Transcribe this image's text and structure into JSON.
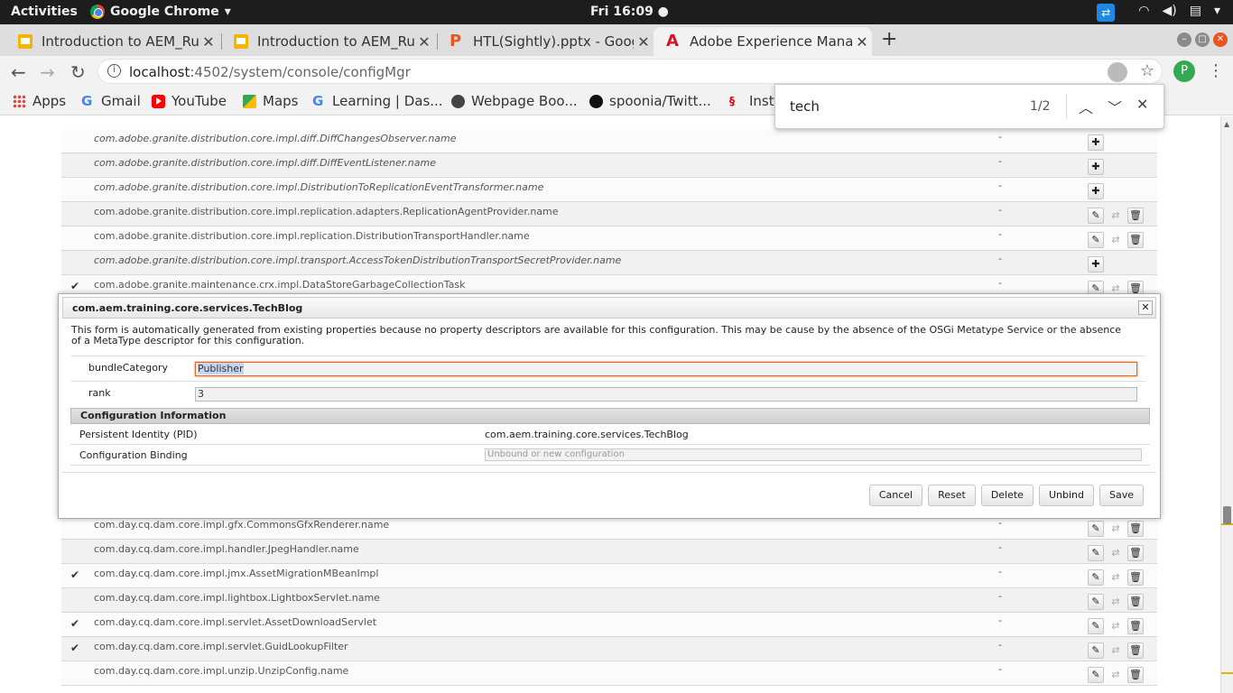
{
  "system": {
    "activities": "Activities",
    "app_name": "Google Chrome",
    "clock": "Fri 16:09 ●"
  },
  "tabs": [
    {
      "title": "Introduction to AEM_Run",
      "icon": "slides-icon",
      "active": false
    },
    {
      "title": "Introduction to AEM_Run",
      "icon": "slides-icon",
      "active": false
    },
    {
      "title": "HTL(Sightly).pptx - Google",
      "icon": "pptx-icon",
      "active": false
    },
    {
      "title": "Adobe Experience Manag",
      "icon": "adobe-icon",
      "active": true
    }
  ],
  "toolbar": {
    "url_host": "localhost",
    "url_rest": ":4502/system/console/configMgr",
    "profile_initial": "P"
  },
  "bookmarks": [
    {
      "label": "Apps",
      "icon": "apps-icon"
    },
    {
      "label": "Gmail",
      "icon": "google-icon"
    },
    {
      "label": "YouTube",
      "icon": "youtube-icon"
    },
    {
      "label": "Maps",
      "icon": "maps-icon"
    },
    {
      "label": "Learning | Das...",
      "icon": "google-icon"
    },
    {
      "label": "Webpage Boo...",
      "icon": "globe-icon"
    },
    {
      "label": "spoonia/Twitt...",
      "icon": "github-icon"
    },
    {
      "label": "Inst",
      "icon": "inst-icon"
    }
  ],
  "find": {
    "query": "tech",
    "count": "1/2"
  },
  "rows_top": [
    {
      "name": "com.adobe.granite.distribution.core.impl.diff.DiffChangesObserver.name",
      "factory": true,
      "checked": false,
      "actions": "add",
      "bound": "-"
    },
    {
      "name": "com.adobe.granite.distribution.core.impl.diff.DiffEventListener.name",
      "factory": true,
      "checked": false,
      "actions": "add",
      "bound": "-"
    },
    {
      "name": "com.adobe.granite.distribution.core.impl.DistributionToReplicationEventTransformer.name",
      "factory": true,
      "checked": false,
      "actions": "add",
      "bound": "-"
    },
    {
      "name": "com.adobe.granite.distribution.core.impl.replication.adapters.ReplicationAgentProvider.name",
      "factory": false,
      "checked": false,
      "actions": "edit",
      "bound": "-"
    },
    {
      "name": "com.adobe.granite.distribution.core.impl.replication.DistributionTransportHandler.name",
      "factory": false,
      "checked": false,
      "actions": "edit",
      "bound": "-"
    },
    {
      "name": "com.adobe.granite.distribution.core.impl.transport.AccessTokenDistributionTransportSecretProvider.name",
      "factory": true,
      "checked": false,
      "actions": "add",
      "bound": "-"
    },
    {
      "name": "com.adobe.granite.maintenance.crx.impl.DataStoreGarbageCollectionTask",
      "factory": false,
      "checked": true,
      "actions": "edit",
      "bound": "-"
    }
  ],
  "rows_bottom": [
    {
      "name": "com.day.cq.dam.core.impl.gfx.CommonsGfxRenderer.name",
      "factory": false,
      "checked": false,
      "actions": "edit",
      "bound": "-"
    },
    {
      "name": "com.day.cq.dam.core.impl.handler.JpegHandler.name",
      "factory": false,
      "checked": false,
      "actions": "edit",
      "bound": "-"
    },
    {
      "name": "com.day.cq.dam.core.impl.jmx.AssetMigrationMBeanImpl",
      "factory": false,
      "checked": true,
      "actions": "edit",
      "bound": "-"
    },
    {
      "name": "com.day.cq.dam.core.impl.lightbox.LightboxServlet.name",
      "factory": false,
      "checked": false,
      "actions": "edit",
      "bound": "-"
    },
    {
      "name": "com.day.cq.dam.core.impl.servlet.AssetDownloadServlet",
      "factory": false,
      "checked": true,
      "actions": "edit",
      "bound": "-"
    },
    {
      "name": "com.day.cq.dam.core.impl.servlet.GuidLookupFilter",
      "factory": false,
      "checked": true,
      "actions": "edit",
      "bound": "-"
    },
    {
      "name": "com.day.cq.dam.core.impl.unzip.UnzipConfig.name",
      "factory": false,
      "checked": false,
      "actions": "edit",
      "bound": "-"
    }
  ],
  "dialog": {
    "title": "com.aem.training.core.services.TechBlog",
    "description": "This form is automatically generated from existing properties because no property descriptors are available for this configuration. This may be cause by the absence of the OSGi Metatype Service or the absence of a MetaType descriptor for this configuration.",
    "properties": [
      {
        "label": "bundleCategory",
        "value": "Publisher"
      },
      {
        "label": "rank",
        "value": "3"
      }
    ],
    "config_info_header": "Configuration Information",
    "pid_label": "Persistent Identity (PID)",
    "pid_value": "com.aem.training.core.services.TechBlog",
    "binding_label": "Configuration Binding",
    "binding_placeholder": "Unbound or new configuration",
    "buttons": [
      "Cancel",
      "Reset",
      "Delete",
      "Unbind",
      "Save"
    ]
  },
  "colors": {
    "focus_border": "#e3671c",
    "ubuntu_close": "#e95420",
    "find_marker": "#e8b200"
  }
}
